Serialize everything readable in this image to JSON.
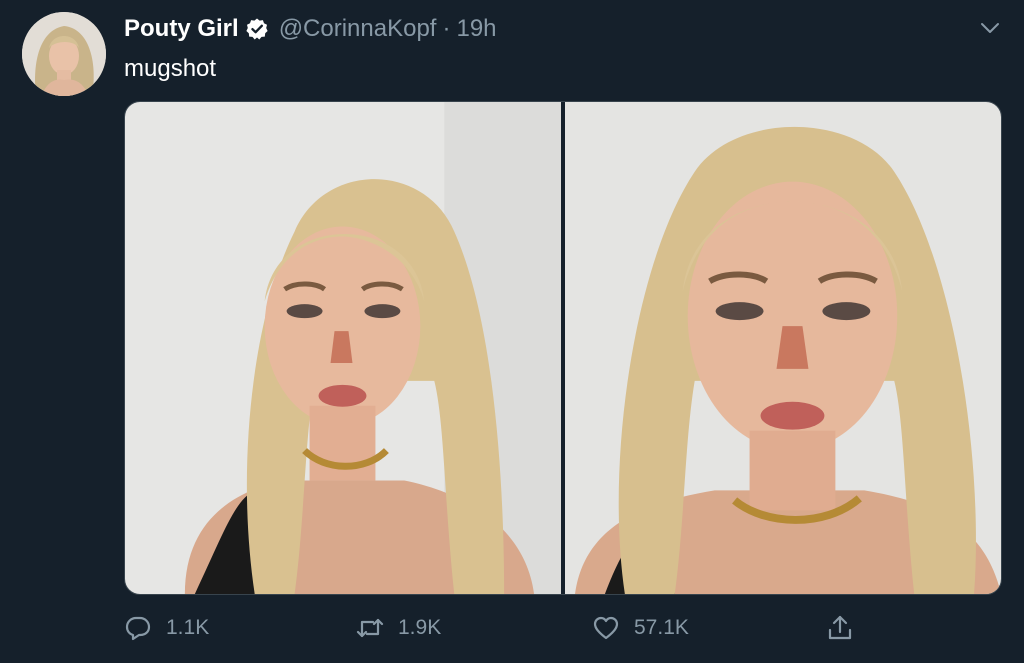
{
  "tweet": {
    "author": {
      "display_name": "Pouty Girl",
      "handle": "@CorinnaKopf",
      "verified": true,
      "avatar_icon": "profile-photo"
    },
    "separator": "·",
    "timestamp": "19h",
    "text": "mugshot",
    "menu_icon": "chevron-down-icon",
    "media": [
      {
        "description_icon": "photo-woman-blonde-hair",
        "alt": "photo 1"
      },
      {
        "description_icon": "photo-woman-blonde-hair",
        "alt": "photo 2"
      }
    ],
    "actions": {
      "reply_count": "1.1K",
      "retweet_count": "1.9K",
      "like_count": "57.1K"
    }
  },
  "colors": {
    "background": "#15202b",
    "text_primary": "#ffffff",
    "text_secondary": "#8899a6",
    "border": "#38444d"
  }
}
